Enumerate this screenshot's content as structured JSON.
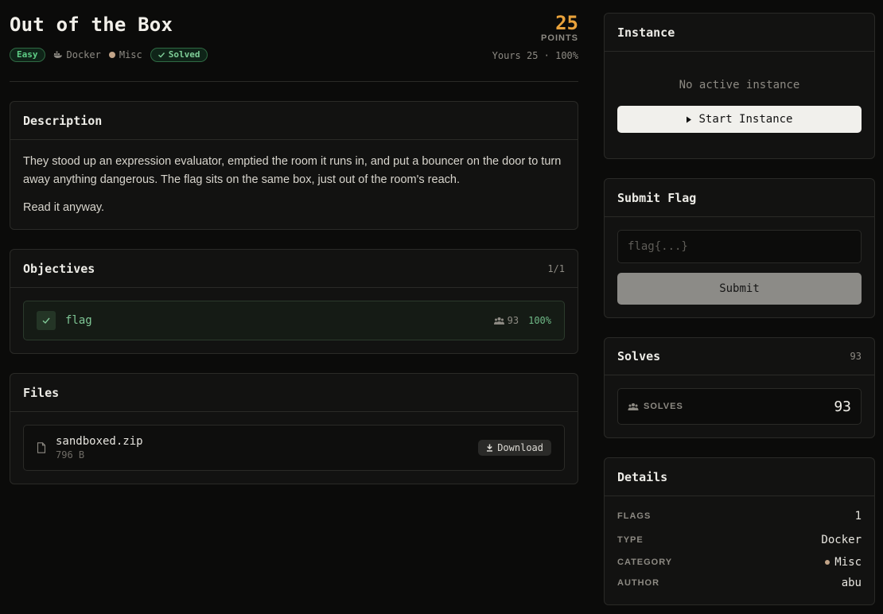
{
  "challenge": {
    "title": "Out of the Box",
    "difficulty": "Easy",
    "type": "Docker",
    "category": "Misc",
    "category_color": "#c2a488",
    "status": "Solved",
    "points": "25",
    "points_label": "POINTS",
    "yours": "Yours 25 · 100%"
  },
  "description": {
    "title": "Description",
    "paragraphs": [
      "They stood up an expression evaluator, emptied the room it runs in, and put a bouncer on the door to turn away anything dangerous. The flag sits on the same box, just out of the room's reach.",
      "Read it anyway."
    ]
  },
  "objectives": {
    "title": "Objectives",
    "count": "1/1",
    "items": [
      {
        "name": "flag",
        "solves": "93",
        "pct": "100%"
      }
    ]
  },
  "files": {
    "title": "Files",
    "items": [
      {
        "name": "sandboxed.zip",
        "size": "796 B",
        "action": "Download"
      }
    ]
  },
  "instance": {
    "title": "Instance",
    "status": "No active instance",
    "start_label": "Start Instance"
  },
  "submit": {
    "title": "Submit Flag",
    "placeholder": "flag{...}",
    "value": "",
    "button": "Submit"
  },
  "solves": {
    "title": "Solves",
    "count": "93",
    "label": "SOLVES",
    "value": "93"
  },
  "details": {
    "title": "Details",
    "rows": [
      {
        "key": "FLAGS",
        "value": "1"
      },
      {
        "key": "TYPE",
        "value": "Docker"
      },
      {
        "key": "CATEGORY",
        "value": "Misc"
      },
      {
        "key": "AUTHOR",
        "value": "abu"
      }
    ]
  },
  "colors": {
    "accent_points": "#e9a23b",
    "success": "#5fcf86",
    "background": "#0b0b0a",
    "card": "#121211"
  },
  "icons": [
    "docker-icon",
    "check-icon",
    "people-icon",
    "file-icon",
    "download-icon",
    "play-icon"
  ]
}
